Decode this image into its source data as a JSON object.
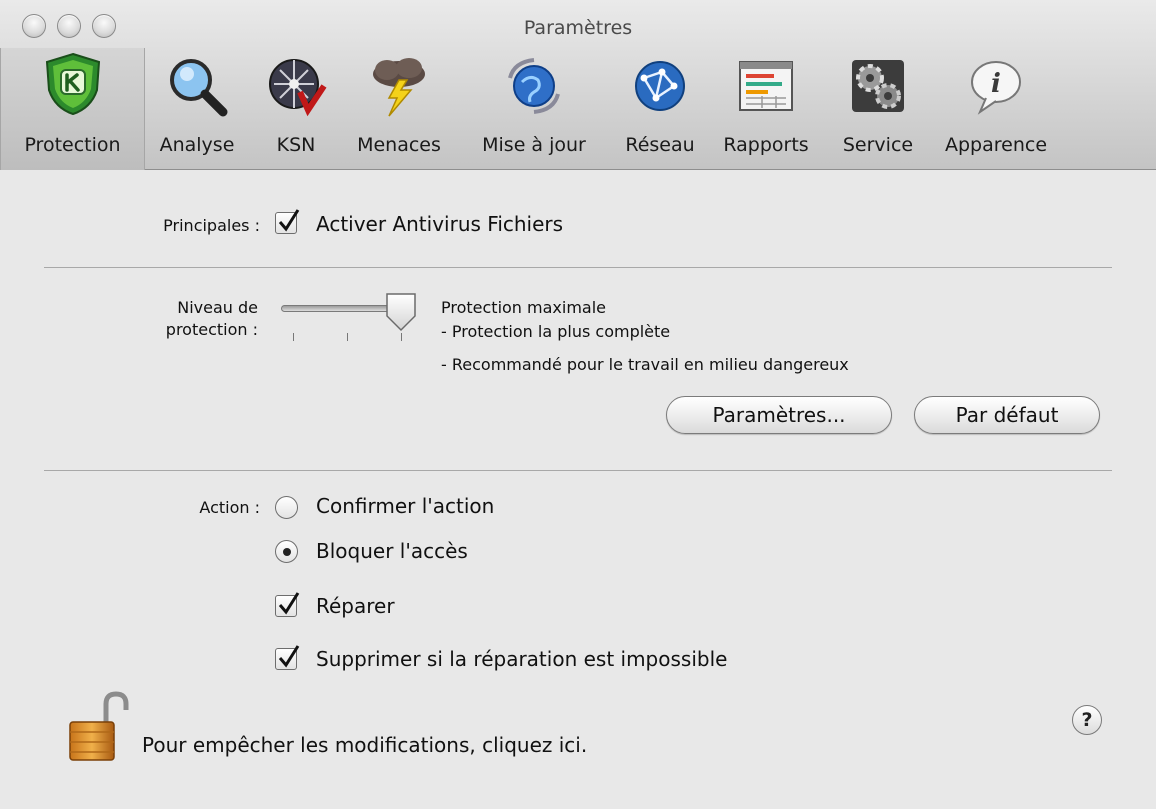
{
  "window": {
    "title": "Paramètres"
  },
  "toolbar": {
    "items": [
      {
        "label": "Protection",
        "icon": "shield-k-icon",
        "selected": true
      },
      {
        "label": "Analyse",
        "icon": "magnifier-icon"
      },
      {
        "label": "KSN",
        "icon": "ksn-globe-icon"
      },
      {
        "label": "Menaces",
        "icon": "storm-cloud-icon"
      },
      {
        "label": "Mise à jour",
        "icon": "update-globe-icon"
      },
      {
        "label": "Réseau",
        "icon": "network-icon"
      },
      {
        "label": "Rapports",
        "icon": "report-icon"
      },
      {
        "label": "Service",
        "icon": "gears-icon"
      },
      {
        "label": "Apparence",
        "icon": "info-bubble-icon"
      }
    ]
  },
  "main": {
    "principales_label": "Principales :",
    "activer_antivirus": {
      "label": "Activer Antivirus Fichiers",
      "checked": true
    },
    "niveau_label_1": "Niveau de",
    "niveau_label_2": "protection :",
    "slider": {
      "position": 3,
      "max": 3
    },
    "level_desc": {
      "title": "Protection maximale",
      "line1": "- Protection la plus complète",
      "line2": "- Recommandé pour le travail en milieu dangereux"
    },
    "buttons": {
      "parametres": "Paramètres...",
      "par_defaut": "Par défaut"
    },
    "action_label": "Action :",
    "confirmer": {
      "label": "Confirmer l'action",
      "selected": false
    },
    "bloquer": {
      "label": "Bloquer l'accès",
      "selected": true
    },
    "reparer": {
      "label": "Réparer",
      "checked": true
    },
    "supprimer": {
      "label": "Supprimer si la réparation est impossible",
      "checked": true
    },
    "lock_text": "Pour empêcher les modifications, cliquez ici.",
    "help": "?"
  },
  "colors": {
    "toolbar_top": "#eaeaea",
    "toolbar_bottom": "#c4c4c4",
    "background": "#e8e8e8"
  }
}
